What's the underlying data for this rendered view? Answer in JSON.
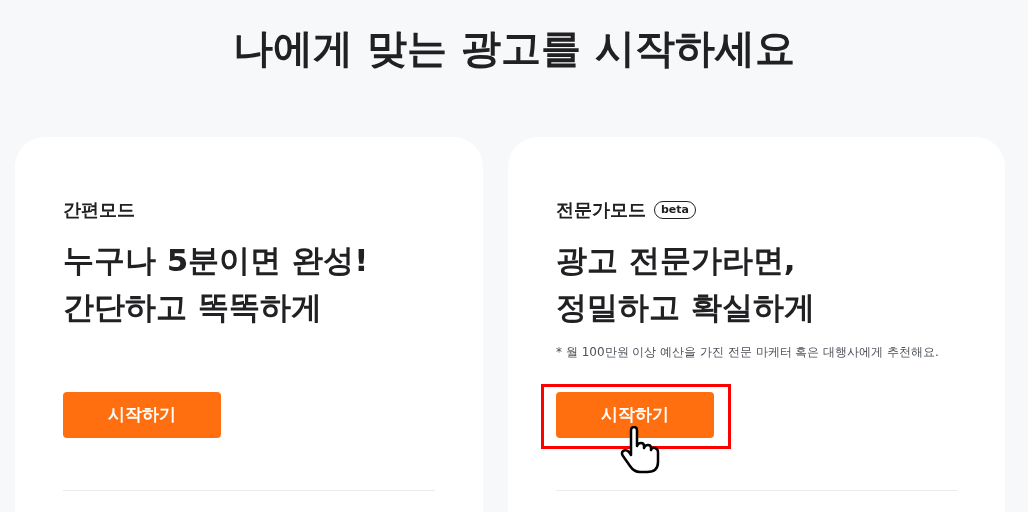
{
  "title": "나에게 맞는 광고를 시작하세요",
  "cards": [
    {
      "mode": "간편모드",
      "headline": [
        "누구나 5분이면 완성!",
        "간단하고 똑똑하게"
      ],
      "button": "시작하기",
      "highlighted": false
    },
    {
      "mode": "전문가모드",
      "badge": "beta",
      "headline": [
        "광고 전문가라면,",
        "정밀하고 확실하게"
      ],
      "note": "* 월 100만원 이상 예산을 가진 전문 마케터 혹은 대행사에게 추천해요.",
      "button": "시작하기",
      "highlighted": true
    }
  ]
}
